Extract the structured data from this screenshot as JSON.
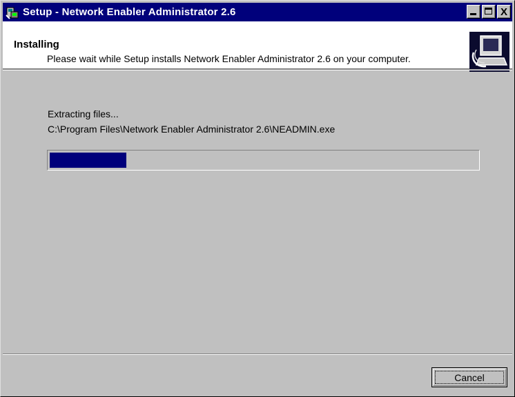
{
  "window": {
    "title": "Setup - Network Enabler Administrator 2.6",
    "icon": "setup-icon",
    "buttons": [
      "minimize-icon",
      "maximize-icon",
      "close-icon"
    ],
    "close_glyph": "X"
  },
  "header": {
    "title": "Installing",
    "description": "Please wait while Setup installs Network Enabler Administrator 2.6 on your computer.",
    "image": "computer-install-icon"
  },
  "main": {
    "status": "Extracting files...",
    "current_file": "C:\\Program Files\\Network Enabler Administrator 2.6\\NEADMIN.exe",
    "progress": 0.18
  },
  "footer": {
    "cancel_label": "Cancel"
  },
  "colors": {
    "titlebar": "#00007b",
    "progress_fill": "#00007b",
    "face": "#c0c0c0"
  }
}
